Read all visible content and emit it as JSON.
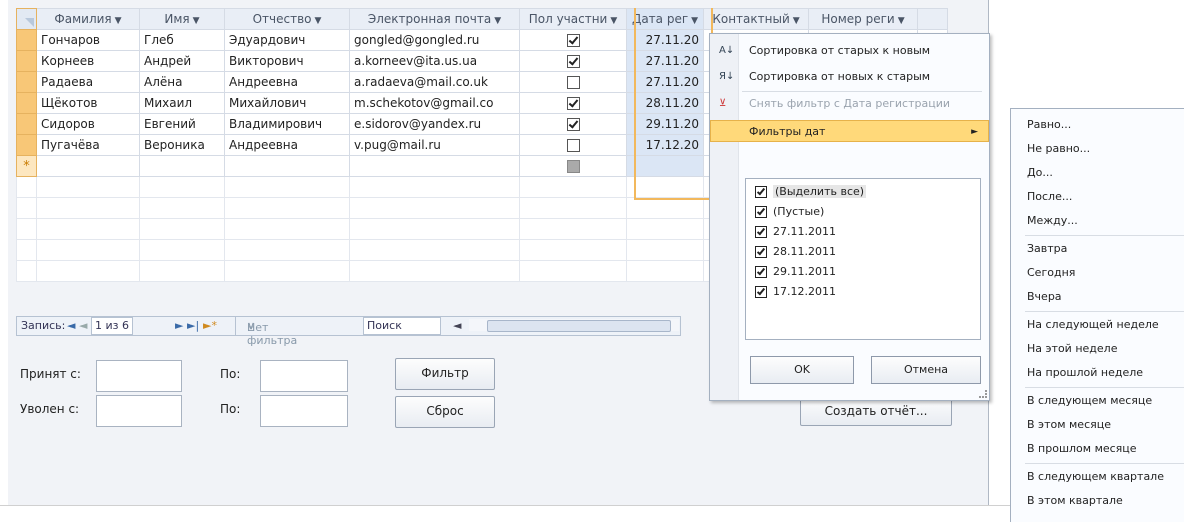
{
  "datasheet": {
    "columns": [
      "Фамилия",
      "Имя",
      "Отчество",
      "Электронная почта",
      "Пол участни",
      "Дата рег",
      "Контактный",
      "Номер реги"
    ],
    "rows": [
      {
        "surname": "Гончаров",
        "name": "Глеб",
        "patronymic": "Эдуардович",
        "email": "gongled@gongled.ru",
        "gender": true,
        "date": "27.11.20"
      },
      {
        "surname": "Корнеев",
        "name": "Андрей",
        "patronymic": "Викторович",
        "email": "a.korneev@ita.us.ua",
        "gender": true,
        "date": "27.11.20"
      },
      {
        "surname": "Радаева",
        "name": "Алёна",
        "patronymic": "Андреевна",
        "email": "a.radaeva@mail.co.uk",
        "gender": false,
        "date": "27.11.20"
      },
      {
        "surname": "Щёкотов",
        "name": "Михаил",
        "patronymic": "Михайлович",
        "email": "m.schekotov@gmail.co",
        "gender": true,
        "date": "28.11.20"
      },
      {
        "surname": "Сидоров",
        "name": "Евгений",
        "patronymic": "Владимирович",
        "email": "e.sidorov@yandex.ru",
        "gender": true,
        "date": "29.11.20"
      },
      {
        "surname": "Пугачёва",
        "name": "Вероника",
        "patronymic": "Андреевна",
        "email": "v.pug@mail.ru",
        "gender": false,
        "date": "17.12.20"
      }
    ],
    "new_row_marker": "*"
  },
  "navbar": {
    "records_label": "Запись:",
    "first": "◄",
    "prev": "◄",
    "position": "1 из 6",
    "next": "►",
    "last": "►|",
    "new": "►*",
    "filter_status": "Нет фильтра",
    "search": "Поиск"
  },
  "form": {
    "hired_from_label": "Принят с:",
    "fired_from_label": "Уволен с:",
    "to_label_1": "По:",
    "to_label_2": "По:",
    "filter_button": "Фильтр",
    "reset_button": "Сброс",
    "report_button": "Создать отчёт..."
  },
  "menu": {
    "sort_asc": "Сортировка от старых к новым",
    "sort_desc": "Сортировка от новых к старым",
    "clear_filter": "Снять фильтр с Дата регистрации",
    "date_filters": "Фильтры дат",
    "checklist": [
      "(Выделить все)",
      "(Пустые)",
      "27.11.2011",
      "28.11.2011",
      "29.11.2011",
      "17.12.2011"
    ],
    "ok": "OK",
    "cancel": "Отмена",
    "icons": {
      "sort_asc": "sort-az-icon",
      "sort_desc": "sort-za-icon",
      "clear_filter": "clear-filter-icon"
    }
  },
  "submenu": {
    "items": [
      "Равно...",
      "Не равно...",
      "До...",
      "После...",
      "Между...",
      "Завтра",
      "Сегодня",
      "Вчера",
      "На следующей неделе",
      "На этой неделе",
      "На прошлой неделе",
      "В следующем месяце",
      "В этом месяце",
      "В прошлом месяце",
      "В следующем квартале",
      "В этом квартале"
    ]
  },
  "colors": {
    "accent_orange": "#f8c777",
    "highlight": "#ffd97a",
    "selected_column": "#dbe6f5"
  }
}
